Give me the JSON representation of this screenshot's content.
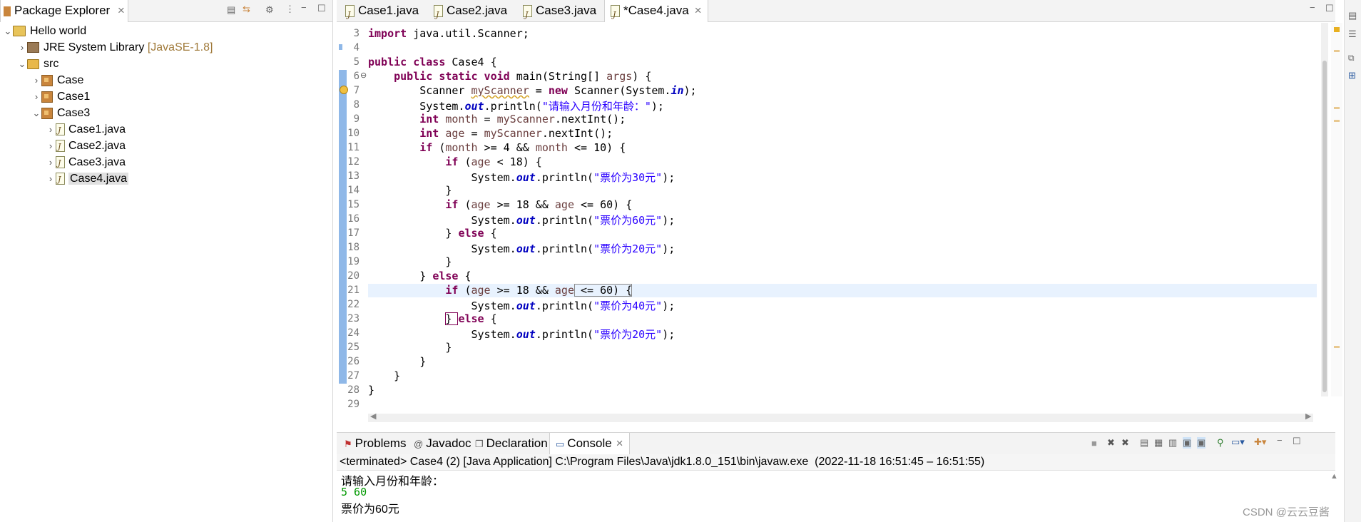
{
  "package_explorer": {
    "title": "Package Explorer",
    "close": "×",
    "tree": [
      {
        "label": "Hello world",
        "decoration": ""
      },
      {
        "label": "JRE System Library",
        "decoration": "[JavaSE-1.8]"
      },
      {
        "label": "src",
        "decoration": ""
      },
      {
        "label": "Case",
        "decoration": ""
      },
      {
        "label": "Case1",
        "decoration": ""
      },
      {
        "label": "Case3",
        "decoration": ""
      },
      {
        "label": "Case1.java",
        "decoration": ""
      },
      {
        "label": "Case2.java",
        "decoration": ""
      },
      {
        "label": "Case3.java",
        "decoration": ""
      },
      {
        "label": "Case4.java",
        "decoration": ""
      }
    ]
  },
  "editor": {
    "tabs": [
      {
        "label": "Case1.java"
      },
      {
        "label": "Case2.java"
      },
      {
        "label": "Case3.java"
      },
      {
        "label": "*Case4.java"
      }
    ],
    "close": "×",
    "line_numbers": [
      "3",
      "4",
      "5",
      "6",
      "7",
      "8",
      "9",
      "10",
      "11",
      "12",
      "13",
      "14",
      "15",
      "16",
      "17",
      "18",
      "19",
      "20",
      "21",
      "22",
      "23",
      "24",
      "25",
      "26",
      "27",
      "28",
      "29"
    ],
    "fold_marker": "⊖",
    "code": {
      "l3_kw": "import",
      "l3_rest": " java.util.Scanner;",
      "l5_kw": "public class",
      "l5_rest": " Case4 {",
      "l6_kw": "public static void",
      "l6_rest": " main(String[] ",
      "l6_var": "args",
      "l6_end": ") {",
      "l7_a": "Scanner ",
      "l7_var": "myScanner",
      "l7_b": " = ",
      "l7_kw": "new",
      "l7_c": " Scanner(System.",
      "l7_fld": "in",
      "l7_d": ");",
      "l8_a": "System.",
      "l8_fld": "out",
      "l8_b": ".println(",
      "l8_str": "\"请输入月份和年龄：\"",
      "l8_c": ");",
      "l9_kw": "int",
      "l9_var1": "month",
      "l9_a": " = ",
      "l9_var2": "myScanner",
      "l9_b": ".nextInt();",
      "l10_kw": "int",
      "l10_var1": "age",
      "l10_a": " = ",
      "l10_var2": "myScanner",
      "l10_b": ".nextInt();",
      "l11_kw": "if",
      "l11_a": " (",
      "l11_var1": "month",
      "l11_b": " >= 4 && ",
      "l11_var2": "month",
      "l11_c": " <= 10) {",
      "l12_kw": "if",
      "l12_a": " (",
      "l12_var": "age",
      "l12_b": " < 18) {",
      "l13_a": "System.",
      "l13_fld": "out",
      "l13_b": ".println(",
      "l13_str": "\"票价为30元\"",
      "l13_c": ");",
      "l14": "}",
      "l15_kw": "if",
      "l15_a": " (",
      "l15_var1": "age",
      "l15_b": " >= 18 && ",
      "l15_var2": "age",
      "l15_c": " <= 60) {",
      "l16_a": "System.",
      "l16_fld": "out",
      "l16_b": ".println(",
      "l16_str": "\"票价为60元\"",
      "l16_c": ");",
      "l17_a": "} ",
      "l17_kw": "else",
      "l17_b": " {",
      "l18_a": "System.",
      "l18_fld": "out",
      "l18_b": ".println(",
      "l18_str": "\"票价为20元\"",
      "l18_c": ");",
      "l19": "}",
      "l20_a": "} ",
      "l20_kw": "else",
      "l20_b": " {",
      "l21_kw": "if",
      "l21_a": " (",
      "l21_var1": "age",
      "l21_b": " >= 18 && ",
      "l21_var2": "age",
      "l21_c": " <= 60) {",
      "l22_a": "System.",
      "l22_fld": "out",
      "l22_b": ".println(",
      "l22_str": "\"票价为40元\"",
      "l22_c": ");",
      "l23_a": "} ",
      "l23_kw": "else",
      "l23_b": " {",
      "l24_a": "System.",
      "l24_fld": "out",
      "l24_b": ".println(",
      "l24_str": "\"票价为20元\"",
      "l24_c": ");",
      "l25": "}",
      "l26": "}",
      "l27": "}",
      "l28": "}"
    }
  },
  "bottom_panel": {
    "tabs": [
      {
        "label": "Problems"
      },
      {
        "label": "Javadoc"
      },
      {
        "label": "Declaration"
      },
      {
        "label": "Console"
      }
    ],
    "close": "×",
    "console_header": "<terminated> Case4 (2) [Java Application] C:\\Program Files\\Java\\jdk1.8.0_151\\bin\\javaw.exe  (2022-11-18 16:51:45 – 16:51:55)",
    "output": [
      "请输入月份和年龄：",
      "5 60",
      "票价为60元"
    ]
  },
  "watermark": "CSDN @云云豆酱",
  "colors": {
    "keyword": "#7f0055",
    "string": "#2a00ff",
    "field": "#0000c0",
    "local_var": "#6a3e3e",
    "console_input": "#009900",
    "current_line": "#e8f2fe"
  }
}
